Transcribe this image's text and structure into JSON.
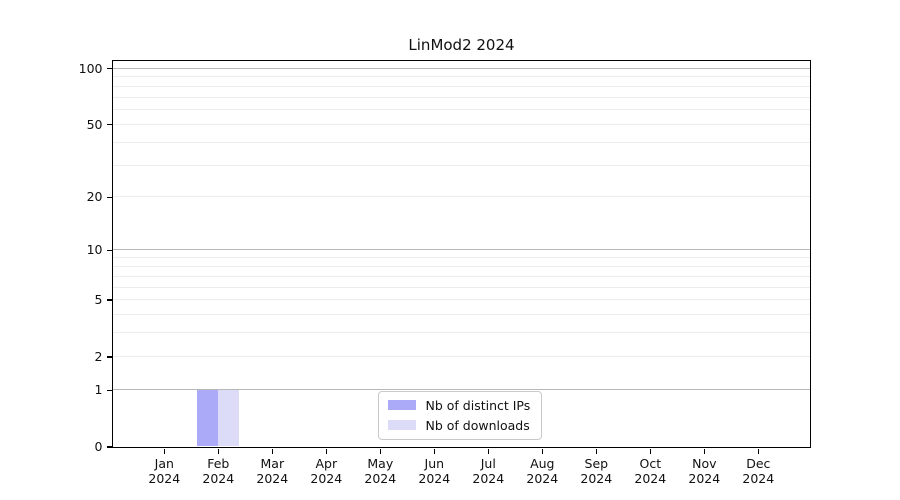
{
  "page": {
    "background": "#ffffff"
  },
  "chart_data": {
    "type": "bar",
    "title": "LinMod2 2024",
    "xlabel": "",
    "ylabel": "",
    "categories": [
      "Jan",
      "Feb",
      "Mar",
      "Apr",
      "May",
      "Jun",
      "Jul",
      "Aug",
      "Sep",
      "Oct",
      "Nov",
      "Dec"
    ],
    "category_year_line": "2024",
    "series": [
      {
        "name": "Nb of distinct IPs",
        "color": "#aaaaf8",
        "values": [
          0,
          1,
          0,
          0,
          0,
          0,
          0,
          0,
          0,
          0,
          0,
          0
        ]
      },
      {
        "name": "Nb of downloads",
        "color": "#dcdcf8",
        "values": [
          0,
          1,
          0,
          0,
          0,
          0,
          0,
          0,
          0,
          0,
          0,
          0
        ]
      }
    ],
    "yscale": "log1p",
    "ylim": [
      0,
      110
    ],
    "yticks": [
      0,
      1,
      2,
      5,
      10,
      20,
      50,
      100
    ],
    "grid_major": [
      1,
      10,
      100
    ],
    "grid_minor": [
      2,
      3,
      4,
      5,
      6,
      7,
      8,
      9,
      20,
      30,
      40,
      50,
      60,
      70,
      80,
      90
    ],
    "legend_position": "lower-center",
    "grid": true,
    "colors": {
      "grid_major": "#b8b8b8",
      "grid_minor": "#ededed",
      "axis": "#000000",
      "text": "#111111",
      "legend_border": "#c9c9c9",
      "legend_bg": "#ffffff"
    }
  }
}
